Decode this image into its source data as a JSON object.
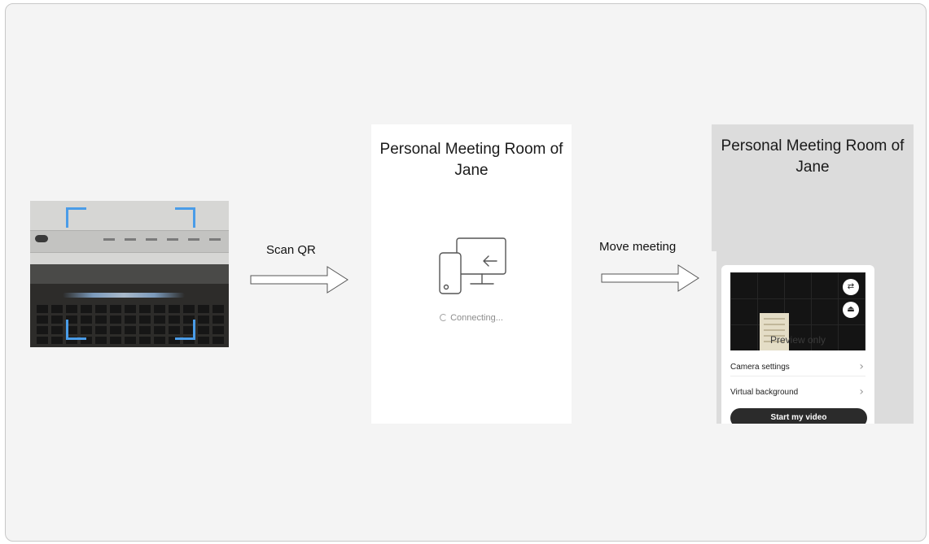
{
  "steps": {
    "scan": {
      "icon": "laptop-camera-photo"
    },
    "arrow1": {
      "label": "Scan QR",
      "icon": "right-arrow-icon"
    },
    "connecting_panel": {
      "title": "Personal Meeting Room of Jane",
      "icon": "phone-to-computer-icon",
      "status": "Connecting..."
    },
    "arrow2": {
      "label": "Move meeting",
      "icon": "right-arrow-icon"
    },
    "meeting_panel": {
      "title": "Personal Meeting Room of Jane",
      "preview_label": "Preview only",
      "rows": [
        {
          "label": "Camera settings",
          "icon": "chevron-right-icon"
        },
        {
          "label": "Virtual background",
          "icon": "chevron-right-icon"
        }
      ],
      "primary_button": "Start my video",
      "icons": [
        "switch-camera-icon",
        "eject-icon"
      ]
    }
  },
  "colors": {
    "background": "#f4f4f4",
    "scan_corner": "#4a9ce8",
    "button_dark": "#2b2b2b"
  }
}
